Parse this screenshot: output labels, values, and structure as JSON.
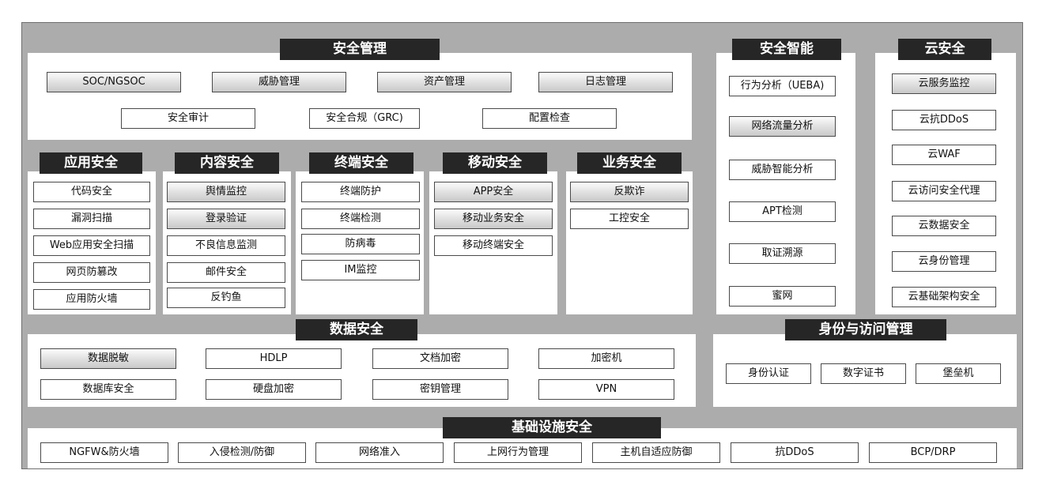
{
  "sections": {
    "security_management": {
      "title": "安全管理",
      "items": [
        "SOC/NGSOC",
        "威胁管理",
        "资产管理",
        "日志管理",
        "安全审计",
        "安全合规（GRC)",
        "配置检查"
      ]
    },
    "security_intelligence": {
      "title": "安全智能",
      "items": [
        "行为分析（UEBA)",
        "网络流量分析",
        "威胁智能分析",
        "APT检测",
        "取证溯源",
        "蜜网"
      ]
    },
    "cloud_security": {
      "title": "云安全",
      "items": [
        "云服务监控",
        "云抗DDoS",
        "云WAF",
        "云访问安全代理",
        "云数据安全",
        "云身份管理",
        "云基础架构安全"
      ]
    },
    "app_security": {
      "title": "应用安全",
      "items": [
        "代码安全",
        "漏洞扫描",
        "Web应用安全扫描",
        "网页防篡改",
        "应用防火墙"
      ]
    },
    "content_security": {
      "title": "内容安全",
      "items": [
        "舆情监控",
        "登录验证",
        "不良信息监测",
        "邮件安全",
        "反钓鱼"
      ]
    },
    "endpoint_security": {
      "title": "终端安全",
      "items": [
        "终端防护",
        "终端检测",
        "防病毒",
        "IM监控"
      ]
    },
    "mobile_security": {
      "title": "移动安全",
      "items": [
        "APP安全",
        "移动业务安全",
        "移动终端安全"
      ]
    },
    "business_security": {
      "title": "业务安全",
      "items": [
        "反欺诈",
        "工控安全"
      ]
    },
    "data_security": {
      "title": "数据安全",
      "items": [
        "数据脱敏",
        "HDLP",
        "文档加密",
        "加密机",
        "数据库安全",
        "硬盘加密",
        "密钥管理",
        "VPN"
      ]
    },
    "identity_access": {
      "title": "身份与访问管理",
      "items": [
        "身份认证",
        "数字证书",
        "堡垒机"
      ]
    },
    "infrastructure_security": {
      "title": "基础设施安全",
      "items": [
        "NGFW&防火墙",
        "入侵检测/防御",
        "网络准入",
        "上网行为管理",
        "主机自适应防御",
        "抗DDoS",
        "BCP/DRP"
      ]
    }
  }
}
